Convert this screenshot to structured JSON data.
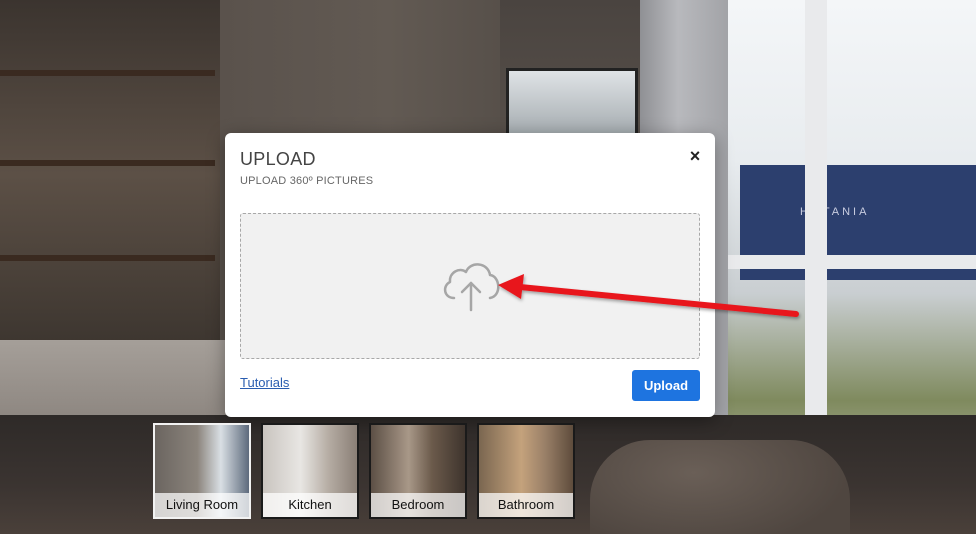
{
  "modal": {
    "title": "UPLOAD",
    "subtitle": "UPLOAD 360º PICTURES",
    "close_icon": "×",
    "dropzone_icon": "cloud-upload-icon",
    "tutorials_link": "Tutorials",
    "upload_button": "Upload"
  },
  "background": {
    "sign_text": "HI TANIA"
  },
  "thumbnails": [
    {
      "label": "Living Room",
      "active": true
    },
    {
      "label": "Kitchen",
      "active": false
    },
    {
      "label": "Bedroom",
      "active": false
    },
    {
      "label": "Bathroom",
      "active": false
    }
  ],
  "colors": {
    "upload_button": "#1e74e0",
    "link": "#2a5db0",
    "annotation_arrow": "#e8141b"
  }
}
